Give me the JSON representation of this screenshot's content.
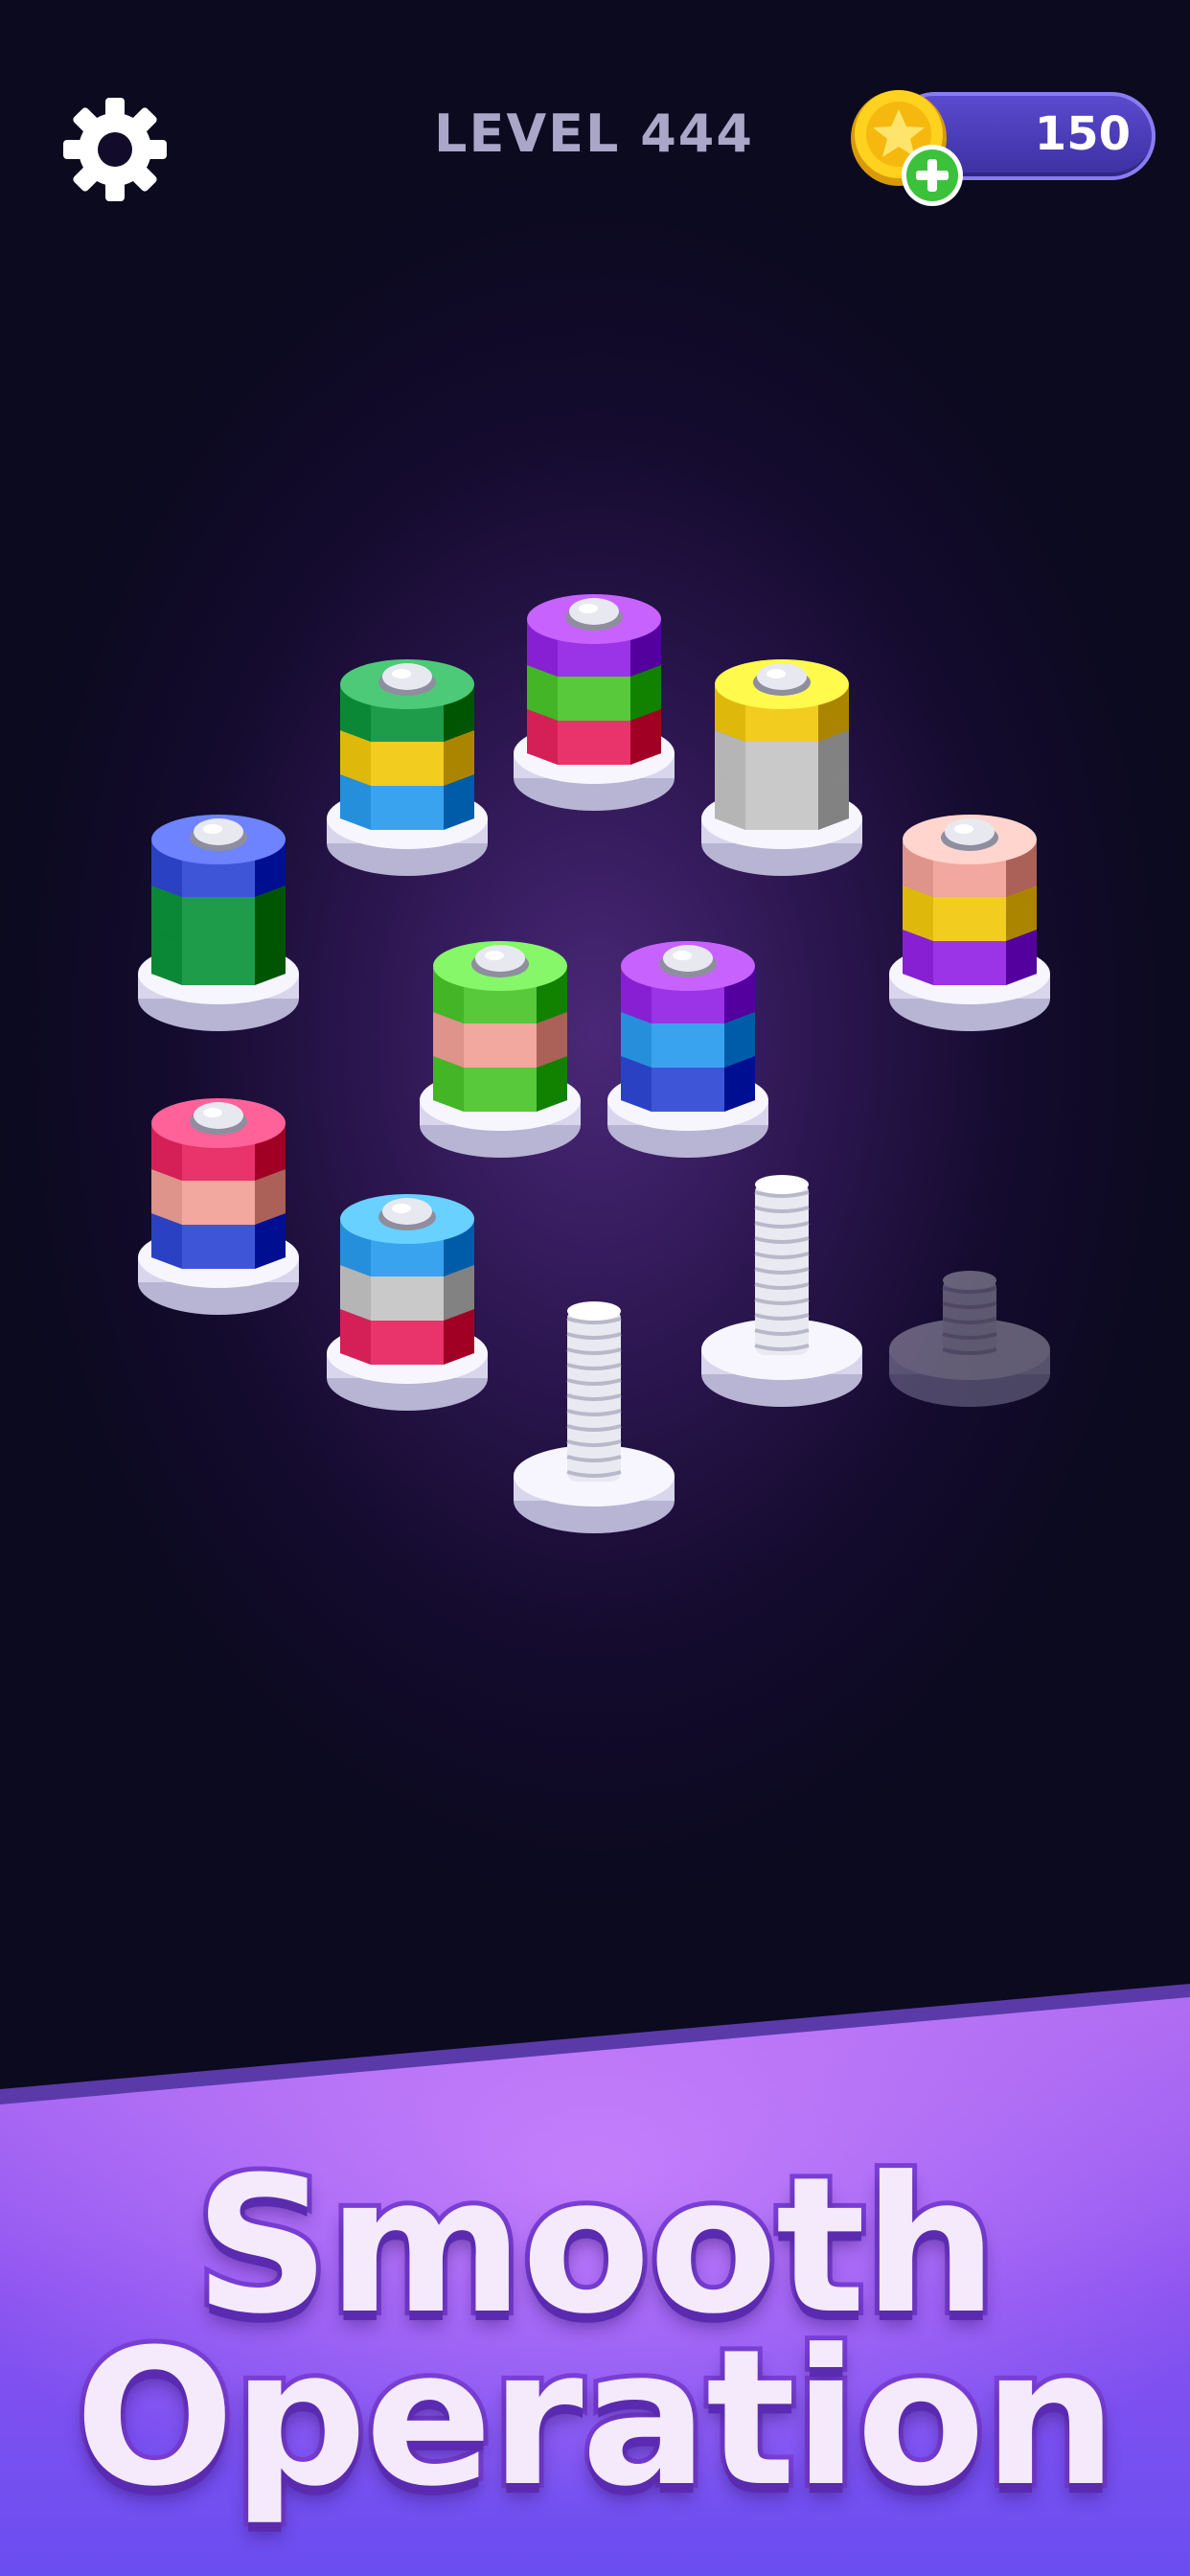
{
  "hud": {
    "level_label": "LEVEL 444",
    "coins": "150",
    "icons": {
      "settings": "gear-icon",
      "coin": "star-coin-icon",
      "add": "plus-icon"
    }
  },
  "board": {
    "bolts": [
      {
        "id": "bolt-1",
        "nuts_top_to_bottom": [
          "green",
          "yellow",
          "lightblue"
        ]
      },
      {
        "id": "bolt-2",
        "nuts_top_to_bottom": [
          "purple",
          "lime",
          "pink"
        ]
      },
      {
        "id": "bolt-3",
        "nuts_top_to_bottom": [
          "yellow",
          "silver",
          "silver"
        ]
      },
      {
        "id": "bolt-4",
        "nuts_top_to_bottom": [
          "blue",
          "green",
          "green"
        ]
      },
      {
        "id": "bolt-5",
        "nuts_top_to_bottom": [
          "peach",
          "yellow",
          "purple"
        ]
      },
      {
        "id": "bolt-6",
        "nuts_top_to_bottom": [
          "lime",
          "peach",
          "lime"
        ]
      },
      {
        "id": "bolt-7",
        "nuts_top_to_bottom": [
          "purple",
          "lightblue",
          "blue"
        ]
      },
      {
        "id": "bolt-8",
        "nuts_top_to_bottom": [
          "pink",
          "peach",
          "blue"
        ]
      },
      {
        "id": "bolt-9",
        "nuts_top_to_bottom": [
          "lightblue",
          "silver",
          "pink"
        ]
      },
      {
        "id": "bolt-10",
        "nuts_top_to_bottom": []
      },
      {
        "id": "bolt-11",
        "nuts_top_to_bottom": []
      },
      {
        "id": "bolt-12",
        "nuts_top_to_bottom": [],
        "locked": true
      }
    ]
  },
  "colors": {
    "green": "#1e9c4a",
    "yellow": "#f2cc1e",
    "lightblue": "#3aa3ef",
    "purple": "#9a34e6",
    "lime": "#57c93a",
    "pink": "#e8336b",
    "silver": "#c9c9c9",
    "blue": "#3f55d8",
    "peach": "#f2a79f"
  },
  "banner": {
    "line1": "Smooth",
    "line2": "Operation"
  }
}
